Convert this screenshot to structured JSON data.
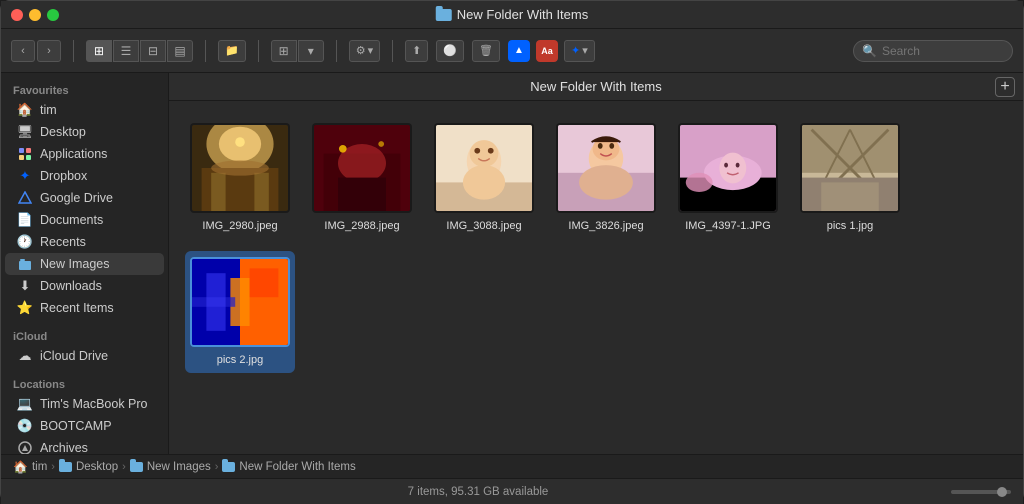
{
  "window": {
    "title": "New Folder With Items"
  },
  "titlebar": {
    "title": "New Folder With Items"
  },
  "toolbar": {
    "search_placeholder": "Search",
    "folder_header": "New Folder With Items"
  },
  "sidebar": {
    "favourites_label": "Favourites",
    "icloud_label": "iCloud",
    "locations_label": "Locations",
    "items": [
      {
        "id": "tim",
        "label": "tim",
        "icon": "🏠"
      },
      {
        "id": "desktop",
        "label": "Desktop",
        "icon": "🖥"
      },
      {
        "id": "applications",
        "label": "Applications",
        "icon": "📁"
      },
      {
        "id": "dropbox",
        "label": "Dropbox",
        "icon": "💧"
      },
      {
        "id": "google-drive",
        "label": "Google Drive",
        "icon": "△"
      },
      {
        "id": "documents",
        "label": "Documents",
        "icon": "📄"
      },
      {
        "id": "recents",
        "label": "Recents",
        "icon": "🕐"
      },
      {
        "id": "new-images",
        "label": "New Images",
        "icon": "📁"
      },
      {
        "id": "downloads",
        "label": "Downloads",
        "icon": "⬇"
      },
      {
        "id": "recent-items",
        "label": "Recent Items",
        "icon": "⭐"
      }
    ],
    "icloud_items": [
      {
        "id": "icloud-drive",
        "label": "iCloud Drive",
        "icon": "☁"
      }
    ],
    "location_items": [
      {
        "id": "macbook",
        "label": "Tim's MacBook Pro",
        "icon": "💻"
      },
      {
        "id": "bootcamp",
        "label": "BOOTCAMP",
        "icon": "💿"
      },
      {
        "id": "archives",
        "label": "Archives",
        "icon": "💾"
      }
    ]
  },
  "files": [
    {
      "id": "img1",
      "name": "IMG_2980.jpeg",
      "selected": false,
      "color1": "#b8860b",
      "color2": "#8b6914",
      "color3": "#d4a017"
    },
    {
      "id": "img2",
      "name": "IMG_2988.jpeg",
      "selected": false,
      "color1": "#8b0000",
      "color2": "#4a0000",
      "color3": "#cc0000"
    },
    {
      "id": "img3",
      "name": "IMG_3088.jpeg",
      "selected": false,
      "color1": "#f5deb3",
      "color2": "#e8c99a",
      "color3": "#d2b48c"
    },
    {
      "id": "img4",
      "name": "IMG_3826.jpeg",
      "selected": false,
      "color1": "#ff69b4",
      "color2": "#ff1493",
      "color3": "#c71585"
    },
    {
      "id": "img5",
      "name": "IMG_4397-1.JPG",
      "selected": false,
      "color1": "#ff69b4",
      "color2": "#8b008b",
      "color3": "#ff00ff"
    },
    {
      "id": "img6",
      "name": "pics 1.jpg",
      "selected": false,
      "color1": "#8b7355",
      "color2": "#696969",
      "color3": "#a0a0a0"
    },
    {
      "id": "img7",
      "name": "pics 2.jpg",
      "selected": true,
      "color1": "#ff8c00",
      "color2": "#0000cd",
      "color3": "#ff4500"
    }
  ],
  "status": {
    "text": "7 items, 95.31 GB available"
  },
  "breadcrumb": {
    "items": [
      "tim",
      "Desktop",
      "New Images",
      "New Folder With Items"
    ]
  },
  "add_button": "+"
}
